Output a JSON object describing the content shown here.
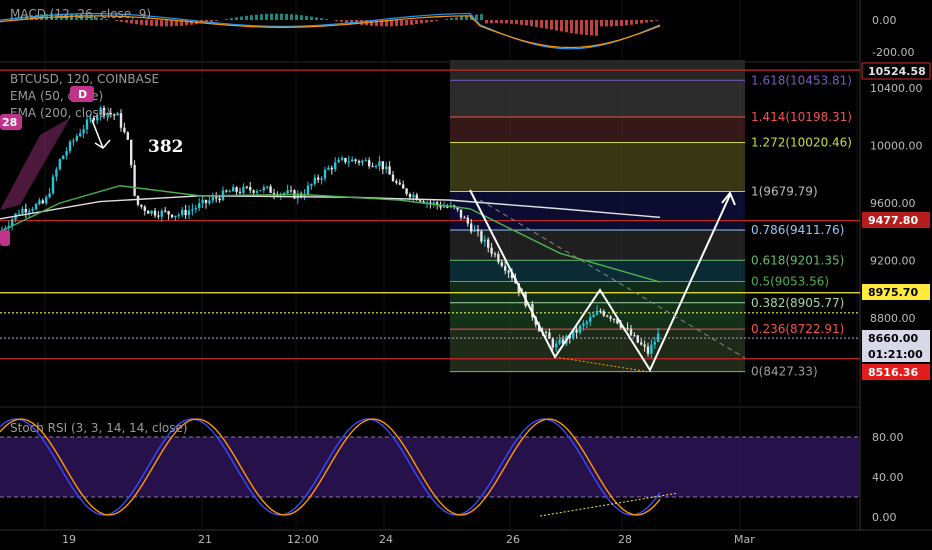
{
  "header": {
    "symbol_line": "BTCUSD, 120, COINBASE",
    "ema50_label": "EMA (50, close)",
    "ema200_label": "EMA (200, close)",
    "macd_label": "MACD (12, 26, close, 9)",
    "stoch_label": "Stoch RSI (3, 3, 14, 14, close)"
  },
  "annotations": {
    "wave_382": "382",
    "badge_d": "D",
    "badge_28": "28"
  },
  "chart_data": [
    {
      "type": "candlestick",
      "pane": "price",
      "title": "BTCUSD, 120, COINBASE",
      "y_ticks": [
        "10400.00",
        "10000.00",
        "9600.00",
        "9200.00",
        "8800.00"
      ],
      "ylim": [
        8300,
        10650
      ],
      "x_ticks": [
        "19",
        "21",
        "12:00",
        "24",
        "26",
        "28",
        "Mar"
      ],
      "price_tags": [
        {
          "value": "10524.58",
          "color": "#e0e0e0",
          "bg": "#000000",
          "border": "#cc2b2b"
        },
        {
          "value": "9477.80",
          "color": "#ffffff",
          "bg": "#b71c1c"
        },
        {
          "value": "8975.70",
          "color": "#000000",
          "bg": "#ffeb3b"
        },
        {
          "value": "8660.00",
          "color": "#000000",
          "bg": "#d8d8e8"
        },
        {
          "value": "01:21:00",
          "color": "#000000",
          "bg": "#d8d8e8"
        },
        {
          "value": "8516.36",
          "color": "#ffffff",
          "bg": "#e31b1b"
        }
      ],
      "horizontal_lines": [
        {
          "value": 10524.58,
          "color": "#c62828"
        },
        {
          "value": 9477.8,
          "color": "#c62828"
        },
        {
          "value": 8975.7,
          "color": "#f5e94a"
        },
        {
          "value": 8836,
          "color": "#f5e94a",
          "style": "dotted"
        },
        {
          "value": 8660,
          "color": "#8b8bb0",
          "style": "dotted"
        },
        {
          "value": 8516.36,
          "color": "#c62828"
        }
      ],
      "fib_levels": [
        {
          "ratio": "1.618",
          "label": "1.618(10453.81)",
          "value": 10453.81,
          "color": "#7e57c2"
        },
        {
          "ratio": "1.414",
          "label": "1.414(10198.31)",
          "value": 10198.31,
          "color": "#ef5350"
        },
        {
          "ratio": "1.272",
          "label": "1.272(10020.46)",
          "value": 10020.46,
          "color": "#cddc39"
        },
        {
          "ratio": "1",
          "label": "1(9679.79)",
          "value": 9679.79,
          "color": "#bdbdbd"
        },
        {
          "ratio": "0.786",
          "label": "0.786(9411.76)",
          "value": 9411.76,
          "color": "#90caf9"
        },
        {
          "ratio": "0.618",
          "label": "0.618(9201.35)",
          "value": 9201.35,
          "color": "#66bb6a"
        },
        {
          "ratio": "0.5",
          "label": "0.5(9053.56)",
          "value": 9053.56,
          "color": "#4caf50"
        },
        {
          "ratio": "0.382",
          "label": "0.382(8905.77)",
          "value": 8905.77,
          "color": "#a5d6a7"
        },
        {
          "ratio": "0.236",
          "label": "0.236(8722.91)",
          "value": 8722.91,
          "color": "#ef5350"
        },
        {
          "ratio": "0",
          "label": "0(8427.33)",
          "value": 8427.33,
          "color": "#9e9e9e"
        }
      ]
    },
    {
      "type": "line",
      "pane": "macd",
      "title": "MACD (12, 26, close, 9)",
      "y_ticks": [
        "0.00",
        "-200.00"
      ],
      "ylim": [
        -260,
        60
      ]
    },
    {
      "type": "line",
      "pane": "stoch_rsi",
      "title": "Stoch RSI (3, 3, 14, 14, close)",
      "y_ticks": [
        "80.00",
        "40.00",
        "0.00"
      ],
      "ylim": [
        -5,
        105
      ],
      "bands": [
        80,
        20
      ]
    }
  ],
  "colors": {
    "candle_up": "#26c6da",
    "candle_down": "#e6e6e6",
    "ema50": "#4caf50",
    "ema200": "#e0e0e0",
    "stoch_k": "#3949ff",
    "stoch_d": "#ff9800",
    "macd_line": "#2196f3",
    "signal_line": "#ff9800",
    "stoch_bg": "#2d1457"
  }
}
